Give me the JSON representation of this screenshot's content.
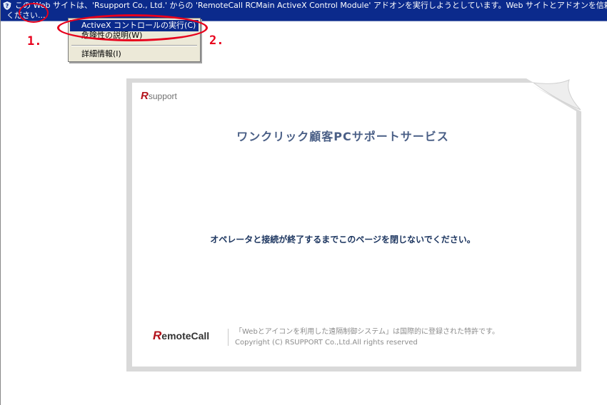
{
  "infobar": {
    "line1": "この Web サイトは、'Rsupport Co., Ltd.' からの 'RemoteCall RCMain ActiveX Control Module' アドオンを実行しようとしています。Web サイトとアドオンを信頼し、アドオンの実行を許",
    "line2": "ください..."
  },
  "steps": {
    "step1": "1.",
    "step2": "2."
  },
  "context_menu": {
    "items": [
      {
        "label": "ActiveX コントロールの実行(C)"
      },
      {
        "label": "危険性の説明(W)"
      },
      {
        "label": "詳細情報(I)"
      }
    ]
  },
  "card": {
    "logo_r": "R",
    "logo_text": "support",
    "title": "ワンクリック顧客PCサポートサービス",
    "message": "オペレータと接続が終了するまでこのページを閉じないでください。",
    "footer": {
      "logo_r": "R",
      "logo_text": "emoteCall",
      "line1": "「Webとアイコンを利用した遠隔制御システム」は国際的に登録された特許です。",
      "line2": "Copyright (C) RSUPPORT Co.,Ltd.All rights reserved"
    }
  },
  "colors": {
    "infobar_bg": "#0b2a8c",
    "annotation_red": "#e8001c",
    "title_color": "#4a5f86",
    "brand_red": "#b3121b"
  },
  "icons": {
    "infobar_icon": "shield-icon"
  }
}
